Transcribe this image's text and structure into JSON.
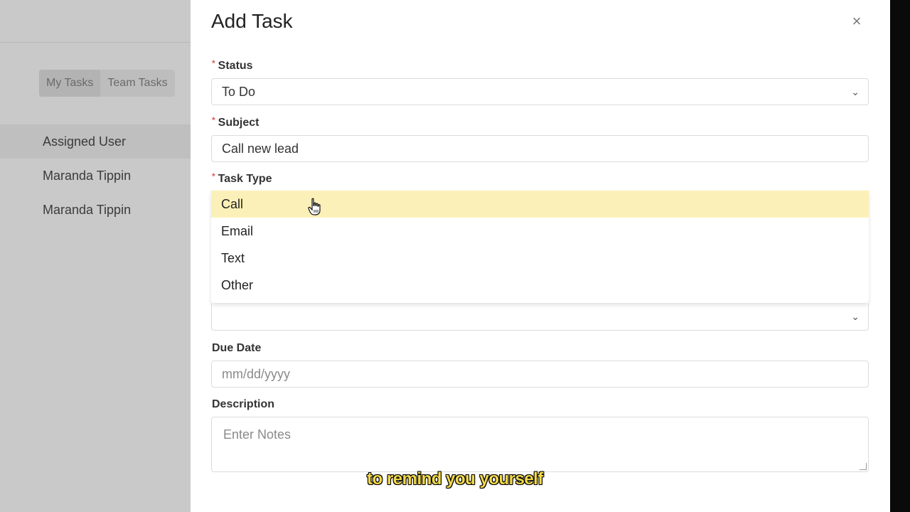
{
  "background": {
    "tabs": [
      {
        "label": "My Tasks"
      },
      {
        "label": "Team Tasks"
      }
    ],
    "table_header": "Assigned User",
    "rows": [
      "Maranda Tippin",
      "Maranda Tippin"
    ]
  },
  "modal": {
    "title": "Add Task",
    "close_glyph": "×",
    "status": {
      "label": "Status",
      "required": "*",
      "value": "To Do"
    },
    "subject": {
      "label": "Subject",
      "required": "*",
      "value": "Call new lead"
    },
    "task_type": {
      "label": "Task Type",
      "required": "*",
      "options": [
        "Call",
        "Email",
        "Text",
        "Other"
      ],
      "highlighted": "Call"
    },
    "chevron_glyph": "⌄",
    "due_date": {
      "label": "Due Date",
      "placeholder": "mm/dd/yyyy"
    },
    "description": {
      "label": "Description",
      "placeholder": "Enter Notes"
    }
  },
  "caption": "to remind you yourself",
  "colors": {
    "highlight": "#fbf1b8",
    "required": "#e05a5a",
    "caption": "#f2d94a",
    "backdrop": "#c9c9c9"
  },
  "icons": {
    "close": "close-icon",
    "chevron": "chevron-down-icon",
    "cursor": "hand-pointer-icon"
  }
}
